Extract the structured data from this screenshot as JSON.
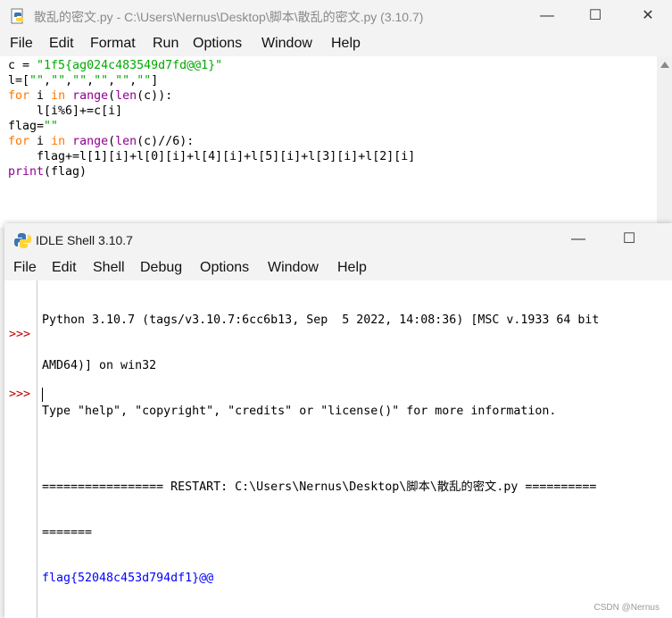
{
  "editor": {
    "title": "散乱的密文.py - C:\\Users\\Nernus\\Desktop\\脚本\\散乱的密文.py (3.10.7)",
    "menu": [
      "File",
      "Edit",
      "Format",
      "Run",
      "Options",
      "Window",
      "Help"
    ],
    "controls": {
      "minimize": "—",
      "maximize": "☐",
      "close": "✕"
    },
    "code": [
      "c = \"1f5{ag024c483549d7fd@@1}\"",
      "l=[\"\",\"\",\"\",\"\",\"\",\"\"]",
      "for i in range(len(c)):",
      "    l[i%6]+=c[i]",
      "flag=\"\"",
      "for i in range(len(c)//6):",
      "    flag+=l[1][i]+l[0][i]+l[4][i]+l[5][i]+l[3][i]+l[2][i]",
      "print(flag)"
    ]
  },
  "shell": {
    "title": "IDLE Shell 3.10.7",
    "menu": [
      "File",
      "Edit",
      "Shell",
      "Debug",
      "Options",
      "Window",
      "Help"
    ],
    "controls": {
      "minimize": "—",
      "maximize": "☐"
    },
    "prompt": ">>>",
    "lines": [
      "Python 3.10.7 (tags/v3.10.7:6cc6b13, Sep  5 2022, 14:08:36) [MSC v.1933 64 bit",
      "AMD64)] on win32",
      "Type \"help\", \"copyright\", \"credits\" or \"license()\" for more information.",
      "",
      "================= RESTART: C:\\Users\\Nernus\\Desktop\\脚本\\散乱的密文.py ==========",
      "=======",
      "flag{52048c453d794df1}@@"
    ]
  },
  "watermark": "CSDN @Nernus"
}
